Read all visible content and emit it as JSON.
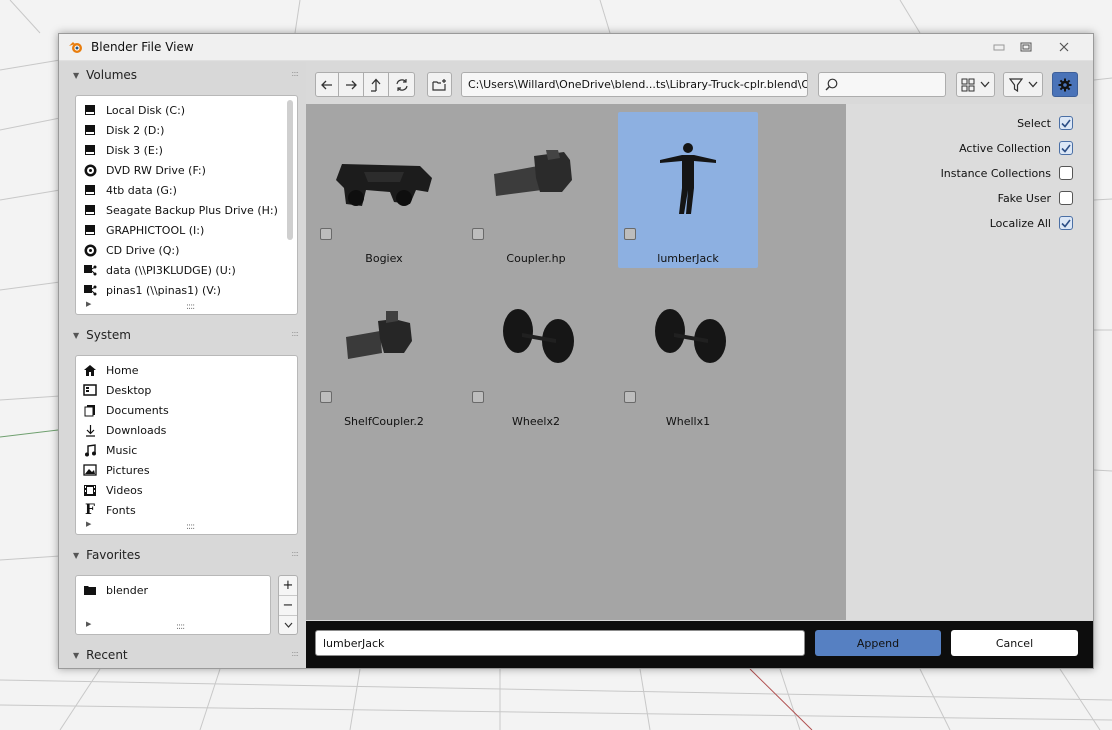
{
  "window": {
    "title": "Blender File View"
  },
  "volumes": {
    "title": "Volumes",
    "items": [
      {
        "label": "Local Disk (C:)",
        "icon": "disk-icon"
      },
      {
        "label": "Disk 2 (D:)",
        "icon": "disk-icon"
      },
      {
        "label": "Disk 3 (E:)",
        "icon": "disk-icon"
      },
      {
        "label": "DVD RW Drive (F:)",
        "icon": "disc-icon"
      },
      {
        "label": "4tb data (G:)",
        "icon": "disk-icon"
      },
      {
        "label": "Seagate Backup Plus Drive (H:)",
        "icon": "disk-icon"
      },
      {
        "label": "GRAPHICTOOL (I:)",
        "icon": "disk-icon"
      },
      {
        "label": "CD Drive (Q:)",
        "icon": "disc-icon"
      },
      {
        "label": "data (\\\\PI3KLUDGE) (U:)",
        "icon": "network-drive-icon"
      },
      {
        "label": "pinas1 (\\\\pinas1) (V:)",
        "icon": "network-drive-icon"
      }
    ]
  },
  "system": {
    "title": "System",
    "items": [
      {
        "label": "Home",
        "icon": "home-icon"
      },
      {
        "label": "Desktop",
        "icon": "desktop-icon"
      },
      {
        "label": "Documents",
        "icon": "documents-icon"
      },
      {
        "label": "Downloads",
        "icon": "download-icon"
      },
      {
        "label": "Music",
        "icon": "music-icon"
      },
      {
        "label": "Pictures",
        "icon": "picture-icon"
      },
      {
        "label": "Videos",
        "icon": "video-icon"
      },
      {
        "label": "Fonts",
        "icon": "font-icon"
      }
    ]
  },
  "favorites": {
    "title": "Favorites",
    "items": [
      {
        "label": "blender",
        "icon": "folder-icon"
      }
    ]
  },
  "recent": {
    "title": "Recent"
  },
  "toolbar": {
    "path": "C:\\Users\\Willard\\OneDrive\\blend...ts\\Library-Truck-cplr.blend\\Object\\",
    "search_placeholder": ""
  },
  "files": [
    {
      "name": "Bogiex",
      "selected": false
    },
    {
      "name": "Coupler.hp",
      "selected": false
    },
    {
      "name": "lumberJack",
      "selected": true
    },
    {
      "name": "ShelfCoupler.2",
      "selected": false
    },
    {
      "name": "Wheelx2",
      "selected": false
    },
    {
      "name": "Whellx1",
      "selected": false
    }
  ],
  "options": [
    {
      "label": "Select",
      "checked": true
    },
    {
      "label": "Active Collection",
      "checked": true
    },
    {
      "label": "Instance Collections",
      "checked": false
    },
    {
      "label": "Fake User",
      "checked": false
    },
    {
      "label": "Localize All",
      "checked": true
    }
  ],
  "bottom": {
    "filename": "lumberJack",
    "append_label": "Append",
    "cancel_label": "Cancel"
  },
  "colors": {
    "selected_tile": "#8db0e1",
    "append_button": "#5680c2",
    "content_bg": "#a5a5a5"
  }
}
